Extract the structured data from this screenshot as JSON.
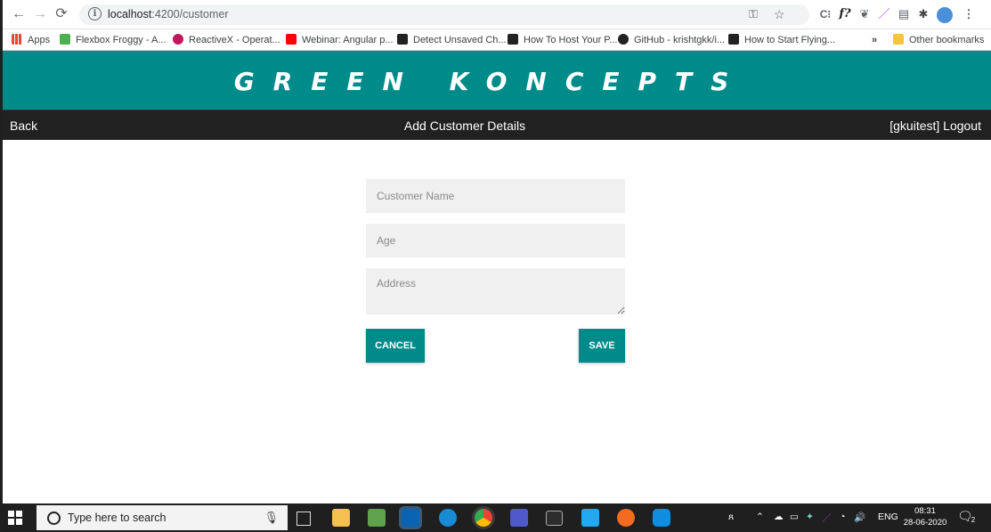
{
  "browser": {
    "url_host": "localhost",
    "url_path": ":4200/customer",
    "bookmarks": [
      {
        "label": "Apps",
        "color": "#e8453c"
      },
      {
        "label": "Flexbox Froggy - A...",
        "color": "#4caf50"
      },
      {
        "label": "ReactiveX - Operat...",
        "color": "#c2185b"
      },
      {
        "label": "Webinar: Angular p...",
        "color": "#ff0000"
      },
      {
        "label": "Detect Unsaved Ch...",
        "color": "#222222"
      },
      {
        "label": "How To Host Your P...",
        "color": "#222222"
      },
      {
        "label": "GitHub - krishtgkk/i...",
        "color": "#222222"
      },
      {
        "label": "How to Start Flying...",
        "color": "#222222"
      }
    ],
    "overflow_label": "»",
    "other_bookmarks": "Other bookmarks"
  },
  "app": {
    "brand": "GREEN KONCEPTS",
    "brand_color": "#008b8b",
    "nav": {
      "back": "Back",
      "title": "Add Customer Details",
      "logout": "[gkuitest] Logout"
    },
    "form": {
      "name_placeholder": "Customer Name",
      "age_placeholder": "Age",
      "address_placeholder": "Address",
      "cancel": "CANCEL",
      "save": "SAVE"
    }
  },
  "taskbar": {
    "search_placeholder": "Type here to search",
    "language": "ENG",
    "time": "08:31",
    "date": "28-06-2020",
    "notification_count": "2"
  }
}
